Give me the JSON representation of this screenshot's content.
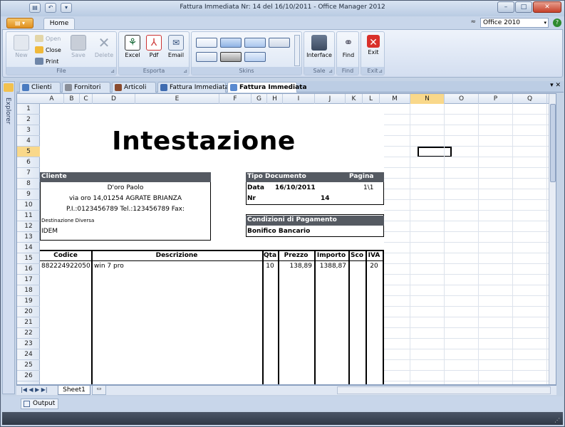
{
  "window": {
    "title": "Fattura Immediata Nr: 14 del 16/10/2011 - Office Manager 2012",
    "min": "–",
    "max": "□",
    "close": "✕"
  },
  "qat": {
    "a": "▤",
    "b": "↶",
    "c": "▾"
  },
  "ribbon_tabs": {
    "app": "▤ ▾",
    "home": "Home",
    "collapse": "≈",
    "skin_value": "Office 2010",
    "skin_dd": "▾",
    "help": "?"
  },
  "ribbon": {
    "file": {
      "label": "File",
      "new": "New",
      "open": "Open",
      "close": "Close",
      "print": "Print",
      "save": "Save",
      "delete": "Delete"
    },
    "esporta": {
      "label": "Esporta",
      "excel": "Excel",
      "pdf": "Pdf",
      "email": "Email"
    },
    "skins": {
      "label": "Skins"
    },
    "sale": {
      "label": "Sale",
      "interface": "Interface"
    },
    "find": {
      "label": "Find",
      "find": "Find"
    },
    "exit": {
      "label": "Exit",
      "exit": "Exit"
    },
    "launcher": "⊿"
  },
  "doc_tabs": [
    "Clienti",
    "Fornitori",
    "Articoli",
    "Fattura Immediata",
    "Fattura Immediata"
  ],
  "doc_tab_ctl": "▾ ✕",
  "explorer_label": "Explorer",
  "columns": [
    "A",
    "B",
    "C",
    "D",
    "E",
    "F",
    "G",
    "H",
    "I",
    "J",
    "K",
    "L",
    "M",
    "N",
    "O",
    "P",
    "Q"
  ],
  "rows": [
    "1",
    "2",
    "3",
    "4",
    "5",
    "6",
    "7",
    "8",
    "9",
    "10",
    "11",
    "12",
    "13",
    "14",
    "15",
    "16",
    "17",
    "18",
    "19",
    "20",
    "21",
    "22",
    "23",
    "24",
    "25",
    "26"
  ],
  "invoice": {
    "heading": "Intestazione",
    "cliente_label": "Cliente",
    "cliente_name": "D'oro Paolo",
    "cliente_addr": "via oro 14,01254 AGRATE BRIANZA",
    "cliente_piva": "P.I.:0123456789 Tel.:123456789 Fax:",
    "dest_label": "Destinazione Diversa",
    "dest_value": "IDEM",
    "tipo_doc_label": "Tipo Documento",
    "pagina_label": "Pagina",
    "data_label": "Data",
    "data_value": "16/10/2011",
    "pagina_value": "1\\1",
    "nr_label": "Nr",
    "nr_value": "14",
    "cond_label": "Condizioni di Pagamento",
    "cond_value": "Bonifico Bancario",
    "headers": {
      "codice": "Codice",
      "descrizione": "Descrizione",
      "qta": "Qta",
      "prezzo": "Prezzo",
      "importo": "Importo",
      "sco": "Sco",
      "iva": "IVA"
    },
    "line1": {
      "codice": "882224922050",
      "descrizione": "win 7 pro",
      "qta": "10",
      "prezzo": "138,89",
      "importo": "1388,87",
      "sco": "",
      "iva": "20"
    }
  },
  "sheet_tab": "Sheet1",
  "sheet_nav": "|◀ ◀ ▶ ▶|",
  "output_label": "Output",
  "colors": {
    "header_dark": "#555a62",
    "selected_header": "#f9d88a"
  }
}
